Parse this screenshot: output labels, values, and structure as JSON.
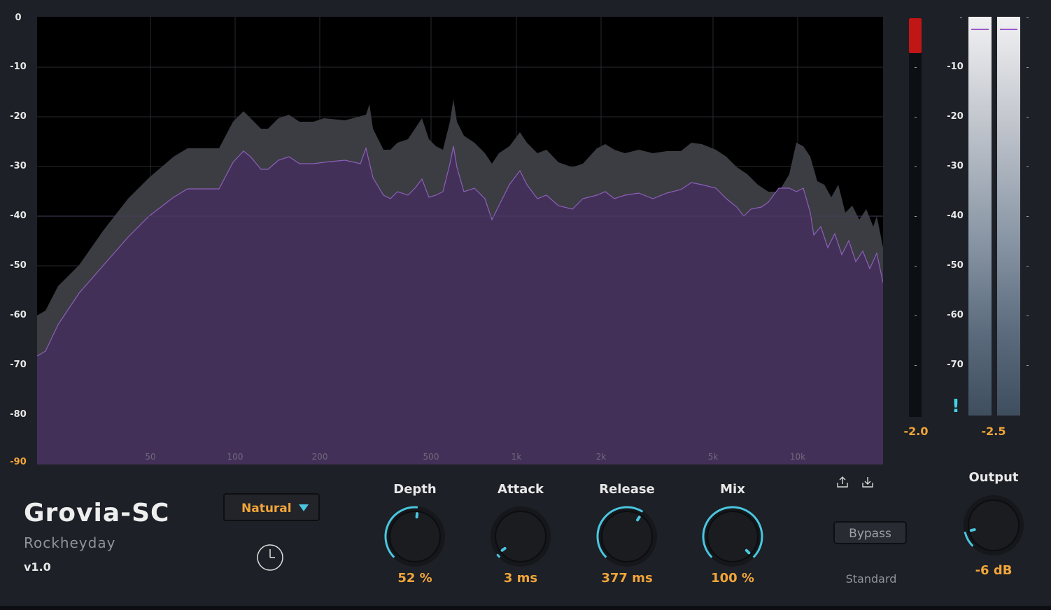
{
  "plugin": {
    "name": "Grovia-SC",
    "company": "Rockheyday",
    "version": "v1.0"
  },
  "spectrum": {
    "db_scale": [
      "0",
      "-10",
      "-20",
      "-30",
      "-40",
      "-50",
      "-60",
      "-70",
      "-80",
      "-90"
    ],
    "freq_labels": [
      "50",
      "100",
      "200",
      "500",
      "1k",
      "2k",
      "5k",
      "10k"
    ],
    "fill_color": "#433059",
    "peak_color": "#3b3d42",
    "line_color": "#8c5fb8"
  },
  "meters": {
    "input_value": "-2.0",
    "output_value": "-2.5",
    "output_scale": [
      "-10",
      "-20",
      "-30",
      "-40",
      "-50",
      "-60",
      "-70"
    ],
    "warning_icon": "exclamation-icon"
  },
  "controls": {
    "mode_dropdown": {
      "selected": "Natural"
    },
    "knobs": [
      {
        "id": "depth",
        "label": "Depth",
        "value": "52 %",
        "fraction": 0.52
      },
      {
        "id": "attack",
        "label": "Attack",
        "value": "3 ms",
        "fraction": 0.03
      },
      {
        "id": "release",
        "label": "Release",
        "value": "377 ms",
        "fraction": 0.62
      },
      {
        "id": "mix",
        "label": "Mix",
        "value": "100 %",
        "fraction": 1.0
      }
    ],
    "output": {
      "label": "Output",
      "value": "-6 dB",
      "fraction": 0.12
    },
    "bypass_label": "Bypass",
    "mode_label": "Standard",
    "accent_color": "#4ac6e0",
    "value_color": "#f2a53a"
  }
}
